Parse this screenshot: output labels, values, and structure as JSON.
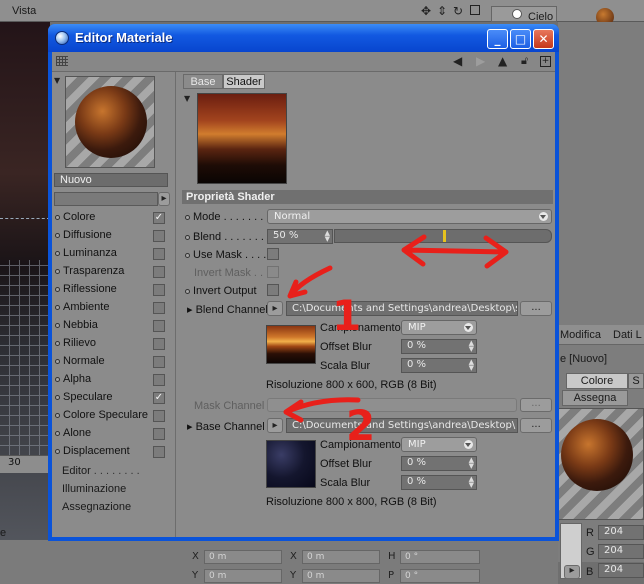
{
  "background": {
    "menu_label": "Vista",
    "object_label": "Cielo",
    "viewport_label": "30",
    "right_tabs": [
      "Modifica",
      "Dati L"
    ],
    "right_new_label": "e [Nuovo]",
    "right_color_tab": "Colore",
    "right_s_tab": "S",
    "right_assign_tab": "Assegna",
    "rgb": [
      {
        "label": "R",
        "value": "204"
      },
      {
        "label": "G",
        "value": "204"
      },
      {
        "label": "B",
        "value": "204"
      }
    ],
    "coords": [
      {
        "label": "X",
        "value": "0 m"
      },
      {
        "label": "X",
        "value": "0 m"
      },
      {
        "label": "H",
        "value": "0 °"
      },
      {
        "label": "Y",
        "value": "0 m"
      },
      {
        "label": "Y",
        "value": "0 m"
      },
      {
        "label": "P",
        "value": "0 °"
      }
    ],
    "bottom_left_char": "e"
  },
  "window": {
    "title": "Editor Materiale",
    "buttons": [
      "_",
      "□",
      "✕"
    ]
  },
  "left_panel": {
    "material_name": "Nuovo",
    "channels": [
      {
        "label": "Colore",
        "checked": true
      },
      {
        "label": "Diffusione",
        "checked": false
      },
      {
        "label": "Luminanza",
        "checked": false
      },
      {
        "label": "Trasparenza",
        "checked": false
      },
      {
        "label": "Riflessione",
        "checked": false
      },
      {
        "label": "Ambiente",
        "checked": false
      },
      {
        "label": "Nebbia",
        "checked": false
      },
      {
        "label": "Rilievo",
        "checked": false
      },
      {
        "label": "Normale",
        "checked": false
      },
      {
        "label": "Alpha",
        "checked": false
      },
      {
        "label": "Speculare",
        "checked": true
      },
      {
        "label": "Colore Speculare",
        "checked": false
      },
      {
        "label": "Alone",
        "checked": false
      },
      {
        "label": "Displacement",
        "checked": false
      }
    ],
    "extra_items": [
      "Editor",
      "Illuminazione",
      "Assegnazione"
    ]
  },
  "tabs": [
    "Base",
    "Shader"
  ],
  "section_title": "Proprietà Shader",
  "properties": {
    "mode_label": "Mode",
    "mode_value": "Normal",
    "blend_label": "Blend",
    "blend_value": "50 %",
    "blend_fraction": 0.5,
    "use_mask_label": "Use Mask",
    "invert_mask_label": "Invert Mask",
    "invert_output_label": "Invert Output",
    "blend_channel_label": "Blend Channel",
    "blend_channel_path": "C:\\Documents and Settings\\andrea\\Desktop\\s",
    "mask_channel_label": "Mask Channel",
    "base_channel_label": "Base Channel",
    "base_channel_path": "C:\\Documents and Settings\\andrea\\Desktop\\",
    "browse_label": "...",
    "sampling_label": "Campionamento",
    "sampling_value": "MIP",
    "offset_blur_label": "Offset Blur",
    "offset_blur_value": "0 %",
    "scale_blur_label": "Scala Blur",
    "scale_blur_value": "0 %",
    "resolution_1": "Risoluzione 800 x 600, RGB (8 Bit)",
    "resolution_2": "Risoluzione 800 x 800, RGB (8 Bit)"
  },
  "annotations": {
    "number_1": "1",
    "number_2": "2",
    "color": "#e8201a"
  }
}
